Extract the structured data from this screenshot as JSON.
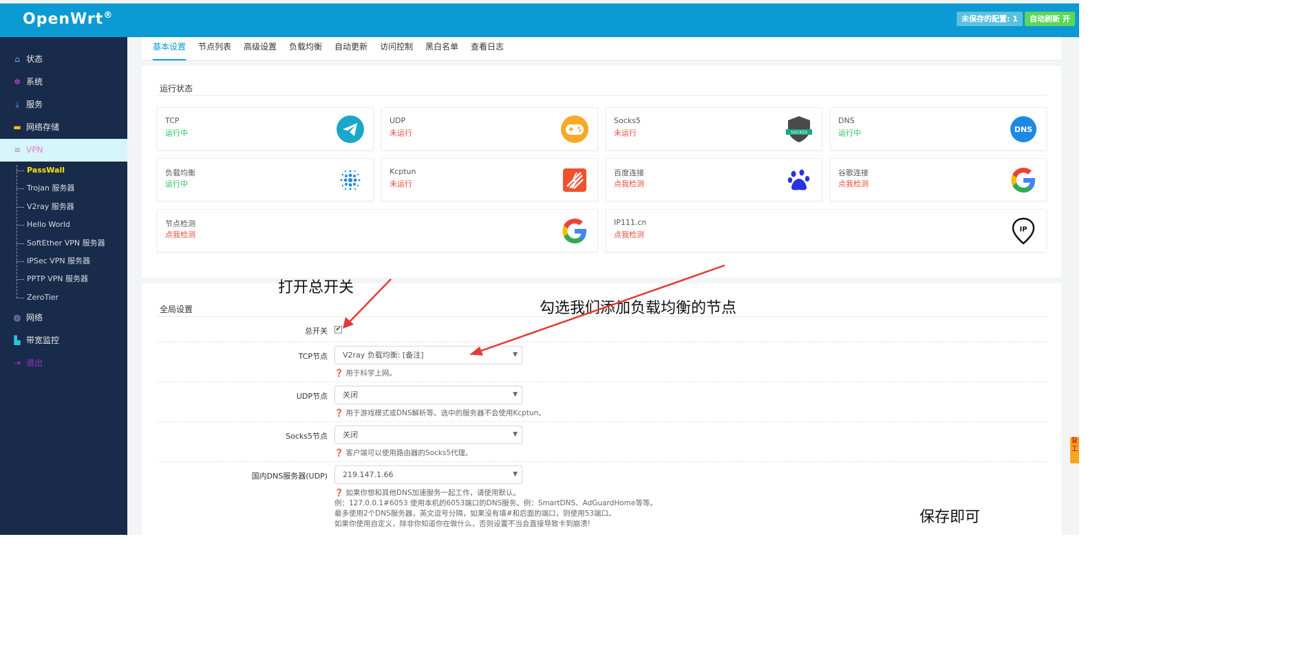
{
  "header": {
    "brand": "OpenWrt",
    "brand_mark": "®",
    "unsaved_label": "未保存的配置: 1",
    "auto_refresh_label": "自动刷新 开"
  },
  "sidebar": {
    "items": [
      {
        "label": "状态",
        "icon": "home-icon"
      },
      {
        "label": "系统",
        "icon": "gears-icon"
      },
      {
        "label": "服务",
        "icon": "download-icon"
      },
      {
        "label": "网络存储",
        "icon": "hdd-icon"
      },
      {
        "label": "VPN",
        "icon": "list-icon"
      },
      {
        "label": "网络",
        "icon": "globe-icon"
      },
      {
        "label": "带宽监控",
        "icon": "bar-chart-icon"
      },
      {
        "label": "退出",
        "icon": "logout-icon"
      }
    ],
    "vpn_sub": [
      "PassWall",
      "Trojan 服务器",
      "V2ray 服务器",
      "Hello World",
      "SoftEther VPN 服务器",
      "IPSec VPN 服务器",
      "PPTP VPN 服务器",
      "ZeroTier"
    ]
  },
  "tabs": [
    "基本设置",
    "节点列表",
    "高级设置",
    "负载均衡",
    "自动更新",
    "访问控制",
    "黑白名单",
    "查看日志"
  ],
  "status": {
    "title": "运行状态",
    "cards": [
      {
        "name": "TCP",
        "state": "运行中"
      },
      {
        "name": "UDP",
        "state": "未运行"
      },
      {
        "name": "Socks5",
        "state": "未运行"
      },
      {
        "name": "DNS",
        "state": "运行中"
      },
      {
        "name": "负载均衡",
        "state": "运行中"
      },
      {
        "name": "Kcptun",
        "state": "未运行"
      },
      {
        "name": "百度连接",
        "state": "点我检测"
      },
      {
        "name": "谷歌连接",
        "state": "点我检测"
      },
      {
        "name": "节点检测",
        "state": "点我检测"
      },
      {
        "name": "IP111.cn",
        "state": "点我检测"
      }
    ],
    "icon_text": {
      "socks": "SOCKS5",
      "dns": "DNS",
      "ip": "IP"
    }
  },
  "global": {
    "title": "全局设置",
    "main_switch_label": "总开关",
    "main_switch_mark": "✔",
    "tcp_label": "TCP节点",
    "tcp_value": "V2ray 负载均衡: [备注]",
    "tcp_help": "❓ 用于科学上网。",
    "udp_label": "UDP节点",
    "udp_value": "关闭",
    "udp_help": "❓ 用于游戏模式或DNS解析等。选中的服务器不会使用Kcptun。",
    "socks_label": "Socks5节点",
    "socks_value": "关闭",
    "socks_help": "❓ 客户端可以使用路由器的Socks5代理。",
    "dns_label": "国内DNS服务器(UDP)",
    "dns_value": "219.147.1.66",
    "dns_help": [
      "❓ 如果你想和其他DNS加速服务一起工作，请使用默认。",
      "例：127.0.0.1#6053 使用本机的6053端口的DNS服务。例：SmartDNS、AdGuardHome等等。",
      "最多使用2个DNS服务器，英文逗号分隔，如果没有填#和后面的端口，则使用53端口。",
      "如果你使用自定义，除非你知道你在做什么，否则设置不当会直接导致卡到崩溃!"
    ],
    "caret": "▼"
  },
  "annotations": {
    "switch_note": "打开总开关",
    "node_note": "勾选我们添加负载均衡的节点",
    "save_note": "保存即可",
    "side_tag": "复工"
  },
  "colors": {
    "header": "#0b9ad3",
    "sidebar": "#192b4a",
    "running": "#22c45e",
    "stopped": "#f04a3d",
    "arrow": "#e53935"
  }
}
